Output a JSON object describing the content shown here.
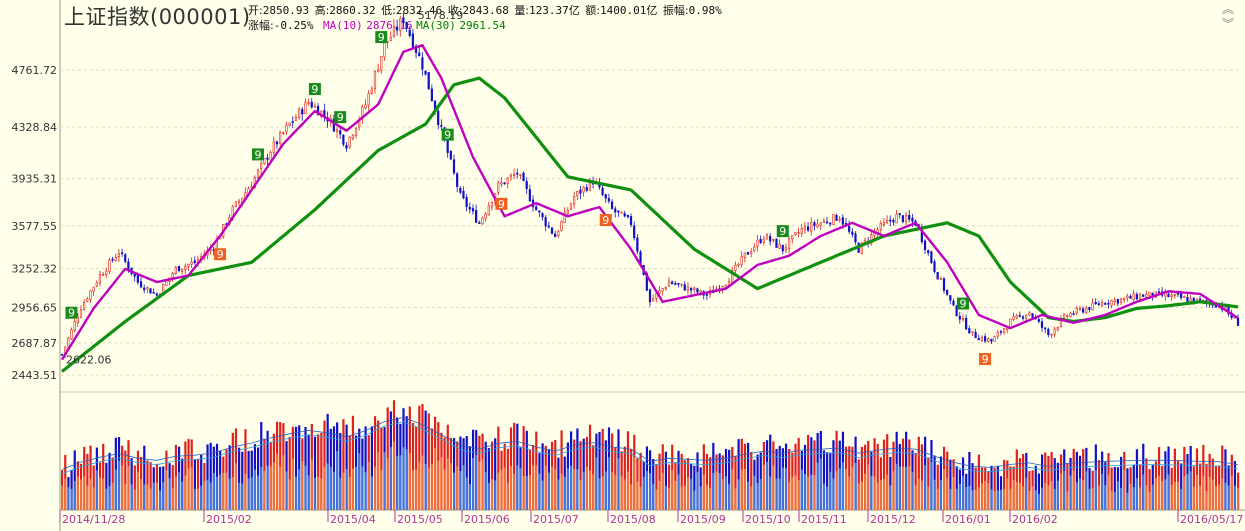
{
  "header": {
    "title": "上证指数(000001)",
    "open_label": "开:",
    "open": "2850.93",
    "high_label": "高:",
    "high": "2860.32",
    "low_label": "低:",
    "low": "2832.46",
    "close_label": "收:",
    "close": "2843.68",
    "volume_label": "量:",
    "volume": "123.37亿",
    "amount_label": "额:",
    "amount": "1400.01亿",
    "amplitude_label": "振幅:",
    "amplitude": "0.98%",
    "change_label": "涨幅:",
    "change": "-0.25%",
    "ma10_label": "MA(10)",
    "ma10": "2876.16",
    "ma30_label": "MA(30)",
    "ma30": "2961.54"
  },
  "colors": {
    "background": "#ffffea",
    "up": "#e0201c",
    "down": "#1010c8",
    "ma10": "#c000c0",
    "ma30": "#109010",
    "grid": "#d9d9c0"
  },
  "chart_data": {
    "type": "candlestick",
    "y_ticks": [
      "4761.72",
      "4328.84",
      "3935.31",
      "3577.55",
      "3252.32",
      "2956.65",
      "2687.87",
      "2443.51"
    ],
    "y_range": [
      2443.51,
      4761.72
    ],
    "annotations": {
      "max_label": "5178.19",
      "min_label": "2622.06"
    },
    "x_labels": [
      "2014/11/28",
      "2015/02",
      "2015/04",
      "2015/05",
      "2015/06",
      "2015/07",
      "2015/08",
      "2015/09",
      "2015/10",
      "2015/11",
      "2015/12",
      "2016/01",
      "2016/02",
      "2016/05/17"
    ],
    "close_path": [
      [
        0,
        2600
      ],
      [
        6,
        2960
      ],
      [
        12,
        3200
      ],
      [
        18,
        3380
      ],
      [
        24,
        3150
      ],
      [
        30,
        3050
      ],
      [
        36,
        3250
      ],
      [
        42,
        3300
      ],
      [
        48,
        3420
      ],
      [
        54,
        3700
      ],
      [
        60,
        3900
      ],
      [
        66,
        4150
      ],
      [
        72,
        4350
      ],
      [
        78,
        4520
      ],
      [
        84,
        4400
      ],
      [
        90,
        4200
      ],
      [
        96,
        4500
      ],
      [
        102,
        4950
      ],
      [
        108,
        5150
      ],
      [
        114,
        4800
      ],
      [
        120,
        4300
      ],
      [
        126,
        3800
      ],
      [
        132,
        3600
      ],
      [
        138,
        3880
      ],
      [
        144,
        3980
      ],
      [
        150,
        3700
      ],
      [
        156,
        3500
      ],
      [
        162,
        3800
      ],
      [
        168,
        3920
      ],
      [
        174,
        3700
      ],
      [
        180,
        3600
      ],
      [
        186,
        3000
      ],
      [
        192,
        3150
      ],
      [
        198,
        3100
      ],
      [
        204,
        3050
      ],
      [
        210,
        3150
      ],
      [
        216,
        3350
      ],
      [
        222,
        3500
      ],
      [
        228,
        3400
      ],
      [
        234,
        3550
      ],
      [
        240,
        3600
      ],
      [
        246,
        3650
      ],
      [
        252,
        3400
      ],
      [
        258,
        3550
      ],
      [
        264,
        3650
      ],
      [
        270,
        3600
      ],
      [
        276,
        3250
      ],
      [
        282,
        2950
      ],
      [
        288,
        2750
      ],
      [
        294,
        2700
      ],
      [
        300,
        2850
      ],
      [
        306,
        2920
      ],
      [
        312,
        2750
      ],
      [
        318,
        2900
      ],
      [
        324,
        2950
      ],
      [
        330,
        3000
      ],
      [
        336,
        3020
      ],
      [
        342,
        3050
      ],
      [
        348,
        3050
      ],
      [
        354,
        3030
      ],
      [
        360,
        3000
      ],
      [
        366,
        2980
      ],
      [
        372,
        2840
      ]
    ],
    "ma10_path": [
      [
        0,
        2560
      ],
      [
        10,
        2950
      ],
      [
        20,
        3250
      ],
      [
        30,
        3150
      ],
      [
        40,
        3200
      ],
      [
        50,
        3500
      ],
      [
        60,
        3850
      ],
      [
        70,
        4200
      ],
      [
        80,
        4450
      ],
      [
        90,
        4300
      ],
      [
        100,
        4500
      ],
      [
        108,
        4900
      ],
      [
        114,
        4950
      ],
      [
        120,
        4700
      ],
      [
        130,
        4100
      ],
      [
        140,
        3650
      ],
      [
        150,
        3750
      ],
      [
        160,
        3650
      ],
      [
        170,
        3720
      ],
      [
        180,
        3400
      ],
      [
        190,
        3000
      ],
      [
        200,
        3050
      ],
      [
        210,
        3100
      ],
      [
        220,
        3280
      ],
      [
        230,
        3350
      ],
      [
        240,
        3500
      ],
      [
        250,
        3600
      ],
      [
        260,
        3500
      ],
      [
        270,
        3600
      ],
      [
        280,
        3300
      ],
      [
        290,
        2900
      ],
      [
        300,
        2800
      ],
      [
        310,
        2900
      ],
      [
        320,
        2840
      ],
      [
        330,
        2900
      ],
      [
        340,
        3000
      ],
      [
        350,
        3080
      ],
      [
        360,
        3060
      ],
      [
        372,
        2876
      ]
    ],
    "ma30_path": [
      [
        0,
        2470
      ],
      [
        20,
        2850
      ],
      [
        40,
        3200
      ],
      [
        60,
        3300
      ],
      [
        80,
        3700
      ],
      [
        100,
        4150
      ],
      [
        115,
        4350
      ],
      [
        124,
        4650
      ],
      [
        132,
        4700
      ],
      [
        140,
        4550
      ],
      [
        160,
        3950
      ],
      [
        180,
        3850
      ],
      [
        200,
        3400
      ],
      [
        220,
        3100
      ],
      [
        240,
        3300
      ],
      [
        260,
        3500
      ],
      [
        280,
        3600
      ],
      [
        290,
        3500
      ],
      [
        300,
        3150
      ],
      [
        312,
        2880
      ],
      [
        320,
        2850
      ],
      [
        330,
        2880
      ],
      [
        340,
        2950
      ],
      [
        350,
        2970
      ],
      [
        360,
        3000
      ],
      [
        372,
        2961
      ]
    ],
    "signals": [
      {
        "i": 3,
        "text": "9",
        "kind": "green"
      },
      {
        "i": 62,
        "text": "9",
        "kind": "green"
      },
      {
        "i": 80,
        "text": "9",
        "kind": "green"
      },
      {
        "i": 88,
        "text": "9",
        "kind": "green"
      },
      {
        "i": 101,
        "text": "9",
        "kind": "green"
      },
      {
        "i": 122,
        "text": "9",
        "kind": "green"
      },
      {
        "i": 228,
        "text": "9",
        "kind": "green"
      },
      {
        "i": 285,
        "text": "9",
        "kind": "green"
      },
      {
        "i": 50,
        "text": "9",
        "kind": "orange"
      },
      {
        "i": 139,
        "text": "9",
        "kind": "orange"
      },
      {
        "i": 172,
        "text": "9",
        "kind": "orange"
      },
      {
        "i": 292,
        "text": "9",
        "kind": "orange"
      }
    ]
  }
}
